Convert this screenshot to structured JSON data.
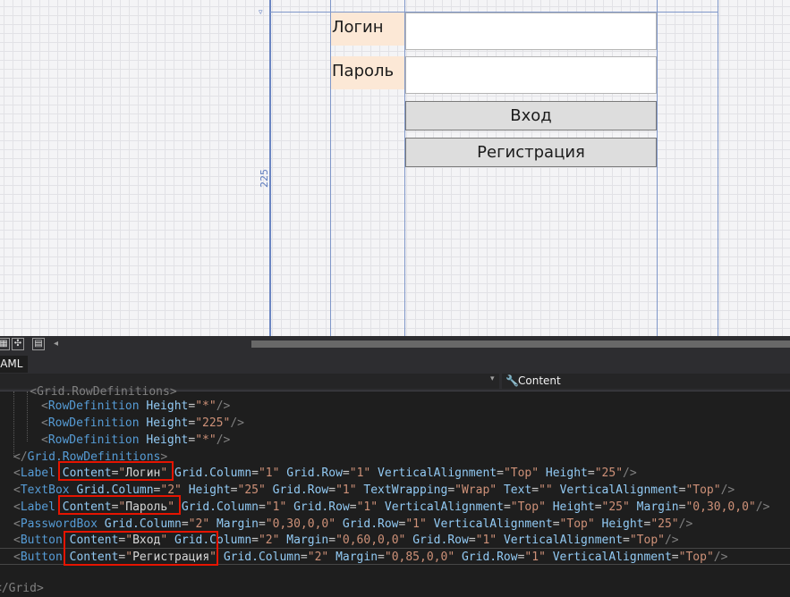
{
  "designer": {
    "row_marker": "▿",
    "row_height_label": "225",
    "label_login": "Логин",
    "label_password": "Пароль",
    "button_login": "Вход",
    "button_register": "Регистрация"
  },
  "toolbar": {
    "icons": [
      "grid-icon",
      "snap-icon",
      "page-icon"
    ],
    "scroll_left": "◂"
  },
  "editor": {
    "tab_label": "XAML",
    "nav_member": "Content"
  },
  "code": {
    "line0": "    <Grid.RowDefinitions>",
    "line1_tag": "RowDefinition",
    "line1_attr": "Height",
    "line1_val": "*",
    "line2_val": "225",
    "line3_val": "*",
    "line4": "Grid.RowDefinitions",
    "line5": {
      "tag": "Label",
      "content": "Логин",
      "rest": [
        [
          "Grid.Column",
          "1"
        ],
        [
          "Grid.Row",
          "1"
        ],
        [
          "VerticalAlignment",
          "Top"
        ],
        [
          "Height",
          "25"
        ]
      ]
    },
    "line6": {
      "tag": "TextBox",
      "rest": [
        [
          "Grid.Column",
          "2"
        ],
        [
          "Height",
          "25"
        ],
        [
          "Grid.Row",
          "1"
        ],
        [
          "TextWrapping",
          "Wrap"
        ],
        [
          "Text",
          ""
        ],
        [
          "VerticalAlignment",
          "Top"
        ]
      ]
    },
    "line7": {
      "tag": "Label",
      "content": "Пароль",
      "rest": [
        [
          "Grid.Column",
          "1"
        ],
        [
          "Grid.Row",
          "1"
        ],
        [
          "VerticalAlignment",
          "Top"
        ],
        [
          "Height",
          "25"
        ],
        [
          "Margin",
          "0,30,0,0"
        ]
      ]
    },
    "line8": {
      "tag": "PasswordBox",
      "rest": [
        [
          "Grid.Column",
          "2"
        ],
        [
          "Margin",
          "0,30,0,0"
        ],
        [
          "Grid.Row",
          "1"
        ],
        [
          "VerticalAlignment",
          "Top"
        ],
        [
          "Height",
          "25"
        ]
      ]
    },
    "line9": {
      "tag": "Button",
      "content": "Вход",
      "rest": [
        [
          "Grid.Column",
          "2"
        ],
        [
          "Margin",
          "0,60,0,0"
        ],
        [
          "Grid.Row",
          "1"
        ],
        [
          "VerticalAlignment",
          "Top"
        ]
      ]
    },
    "line10": {
      "tag": "Button",
      "content": "Регистрация",
      "rest": [
        [
          "Grid.Column",
          "2"
        ],
        [
          "Margin",
          "0,85,0,0"
        ],
        [
          "Grid.Row",
          "1"
        ],
        [
          "VerticalAlignment",
          "Top"
        ]
      ]
    },
    "line11": "</Grid>"
  },
  "colors": {
    "highlight_box": "#e51400",
    "grid_line": "#7f97c9",
    "label_bg": "#fce8d6"
  }
}
